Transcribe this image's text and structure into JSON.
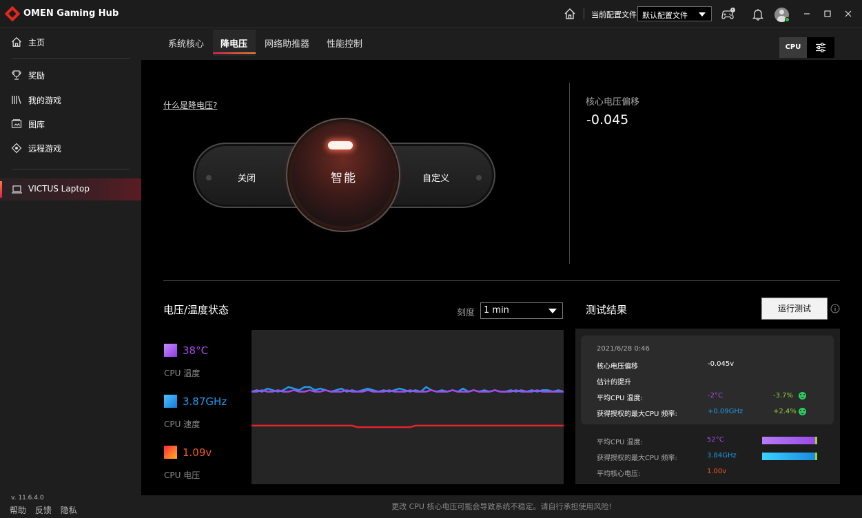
{
  "app": {
    "title": "OMEN Gaming Hub"
  },
  "titlebar": {
    "profile_label": "当前配置文件",
    "profile_value": "默认配置文件",
    "icons": [
      "home-icon",
      "gamepad-icon",
      "bell-icon",
      "user-avatar",
      "minimize-icon",
      "maximize-icon",
      "close-icon"
    ]
  },
  "sidebar": {
    "items": [
      {
        "label": "主页",
        "icon": "home-icon"
      },
      {
        "label": "奖励",
        "icon": "trophy-icon"
      },
      {
        "label": "我的游戏",
        "icon": "library-icon"
      },
      {
        "label": "图库",
        "icon": "gallery-icon"
      },
      {
        "label": "远程游戏",
        "icon": "remote-play-icon"
      }
    ],
    "device": {
      "label": "VICTUS Laptop",
      "icon": "laptop-icon"
    },
    "version": "v. 11.6.4.0",
    "footer_links": [
      "帮助",
      "反馈",
      "隐私"
    ]
  },
  "tabs": {
    "items": [
      "系统核心",
      "降电压",
      "网络助推器",
      "性能控制"
    ],
    "active_index": 1,
    "cpu_toggle": "CPU"
  },
  "undervolt": {
    "what_link": "什么是降电压?",
    "modes": {
      "off": "关闭",
      "smart": "智能",
      "custom": "自定义"
    },
    "selected_mode": "智能",
    "offset_label": "核心电压偏移",
    "offset_value": "-0.045"
  },
  "status": {
    "title": "电压/温度状态",
    "scale_label": "刻度",
    "scale_value": "1 min",
    "metrics": [
      {
        "value": "38°C",
        "label": "CPU 温度",
        "color": "#a54bea"
      },
      {
        "value": "3.87GHz",
        "label": "CPU 速度",
        "color": "#1e9be8"
      },
      {
        "value": "1.09v",
        "label": "CPU 电压",
        "color": "#f05a24"
      }
    ]
  },
  "chart_data": {
    "type": "line",
    "title": "",
    "xlabel": "",
    "ylabel": "",
    "ylim": [
      0,
      100
    ],
    "series": [
      {
        "color": "#1e9be8",
        "values": [
          60,
          61,
          60,
          62,
          61,
          60,
          61,
          63,
          62,
          61,
          63,
          63,
          61,
          62,
          61,
          60,
          61,
          62,
          60,
          61,
          60,
          61,
          62,
          61,
          60,
          61,
          60,
          61,
          62,
          61,
          60,
          61,
          60,
          63,
          61,
          60,
          61,
          60,
          61,
          60,
          62,
          60,
          61,
          60,
          61,
          60,
          61,
          60,
          60,
          61,
          60,
          61,
          60,
          61,
          60,
          61,
          61,
          60,
          61,
          60
        ]
      },
      {
        "color": "#a54bea",
        "values": [
          60,
          60,
          61,
          60,
          60,
          61,
          60,
          60,
          61,
          60,
          60,
          61,
          60,
          60,
          61,
          60,
          60,
          60,
          61,
          60,
          60,
          60,
          61,
          60,
          60,
          60,
          61,
          60,
          60,
          60,
          61,
          60,
          60,
          60,
          61,
          60,
          60,
          60,
          61,
          60,
          60,
          60,
          61,
          60,
          60,
          60,
          61,
          60,
          60,
          60,
          61,
          60,
          60,
          60,
          61,
          60,
          60,
          60,
          60,
          60
        ]
      },
      {
        "color": "#e4232f",
        "values": [
          38,
          38,
          38,
          38,
          38,
          38,
          38,
          38,
          38,
          38,
          38,
          38,
          38,
          38,
          38,
          38,
          38,
          38,
          38,
          38,
          37,
          37,
          37,
          37,
          37,
          37,
          37,
          37,
          37,
          37,
          37,
          38,
          38,
          38,
          38,
          38,
          38,
          38,
          38,
          38,
          38,
          38,
          38,
          38,
          38,
          38,
          38,
          38,
          38,
          38,
          38,
          38,
          38,
          38,
          38,
          38,
          38,
          38,
          38,
          38
        ]
      }
    ]
  },
  "test": {
    "title": "测试结果",
    "run_button": "运行测试",
    "timestamp": "2021/6/28 0:46",
    "offset_label": "核心电压偏移",
    "offset_value": "-0.045v",
    "improve_label": "估计的提升",
    "avg_temp_label": "平均CPU 温度:",
    "avg_temp_delta": "-2°C",
    "avg_temp_pct": "-3.7%",
    "max_freq_label": "获得授权的最大CPU 频率:",
    "max_freq_delta": "+0.09GHz",
    "max_freq_pct": "+2.4%",
    "summary": [
      {
        "label": "平均CPU 温度:",
        "value": "52°C",
        "color": "#a54bea",
        "bar_fraction": 0.97
      },
      {
        "label": "获得授权的最大CPU 频率:",
        "value": "3.84GHz",
        "color": "#1e9be8",
        "bar_fraction": 0.97
      },
      {
        "label": "平均核心电压:",
        "value": "1.00v",
        "color": "#f05a24"
      }
    ],
    "delta_color": "#a54bea",
    "freq_color": "#1e9be8",
    "pct_color": "#8fd13a"
  },
  "footer": {
    "warning": "更改 CPU 核心电压可能会导致系统不稳定。请自行承担使用风险!"
  }
}
